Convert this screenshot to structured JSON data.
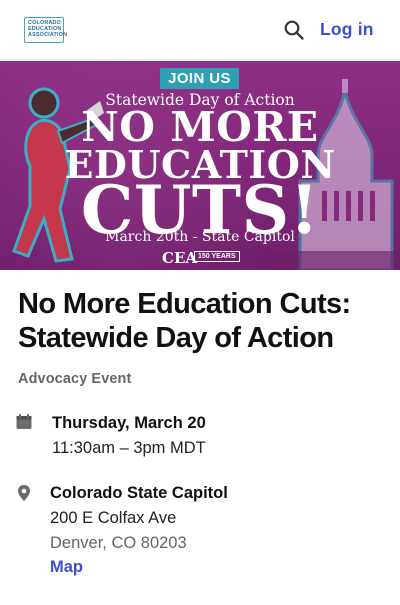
{
  "header": {
    "logo_lines": [
      "COLORADO",
      "EDUCATION",
      "ASSOCIATION"
    ],
    "search_icon": "search-icon",
    "login_label": "Log in"
  },
  "banner": {
    "join_label": "JOIN US",
    "subtitle": "Statewide Day of Action",
    "headline_line1": "NO MORE",
    "headline_line2": "EDUCATION",
    "headline_line3": "CUTS!",
    "date_line": "March 20th - State Capitol",
    "cea_mark": "CEA",
    "anniversary_badge": "150 YEARS"
  },
  "event": {
    "title": "No More Education Cuts: Statewide Day of Action",
    "type": "Advocacy Event",
    "date": "Thursday, March 20",
    "time": "11:30am – 3pm MDT",
    "venue": "Colorado State Capitol",
    "address_line1": "200 E Colfax Ave",
    "address_line2": "Denver, CO 80203",
    "map_link": "Map",
    "calendar_icon": "calendar-icon",
    "location_icon": "map-pin-icon"
  },
  "colors": {
    "accent": "#3d4fd0",
    "banner_purple": "#8e2f86",
    "banner_teal": "#2f9fb4"
  }
}
